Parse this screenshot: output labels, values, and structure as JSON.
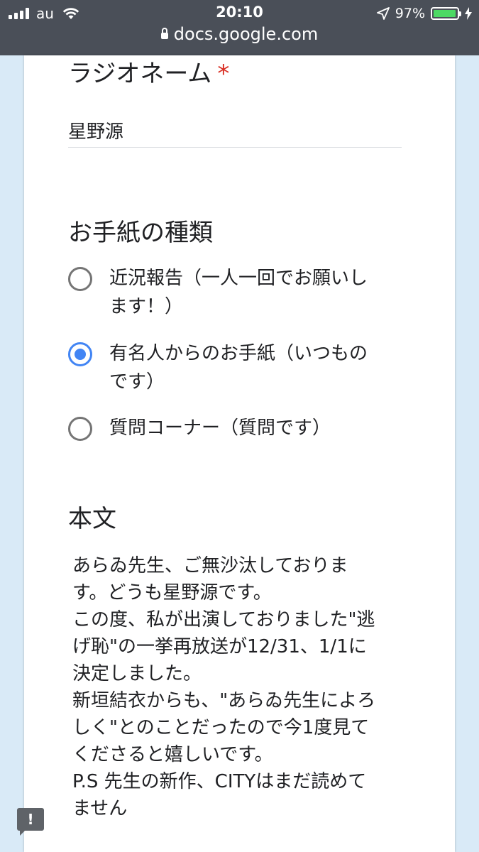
{
  "status_bar": {
    "carrier": "au",
    "time": "20:10",
    "battery": "97%",
    "battery_level": 0.97,
    "url": "docs.google.com"
  },
  "form": {
    "name_question": {
      "title": "ラジオネーム",
      "required_mark": "*",
      "answer": "星野源"
    },
    "type_question": {
      "title": "お手紙の種類",
      "options": [
        {
          "line1": "近況報告（一人一回でお願いし",
          "line2": "ます！）",
          "selected": false
        },
        {
          "line1": "有名人からのお手紙（いつもの",
          "line2": "です）",
          "selected": true
        },
        {
          "line1": "質問コーナー（質問です）",
          "line2": "",
          "selected": false
        }
      ]
    },
    "body_question": {
      "title": "本文",
      "lines": [
        "あらゐ先生、ご無沙汰しておりま",
        "す。どうも星野源です。",
        "この度、私が出演しておりました\"逃",
        "げ恥\"の一挙再放送が12/31、1/1に",
        "決定しました。",
        "新垣結衣からも、\"あらゐ先生によろ",
        "しく\"とのことだったので今1度見て",
        "くださると嬉しいです。",
        "P.S 先生の新作、CITYはまだ読めて",
        "ません"
      ]
    }
  },
  "report_button": "!",
  "colors": {
    "status_bar_bg": "#4a4f58",
    "radio_selected": "#4285f4",
    "required": "#d93025",
    "battery": "#4cd964"
  }
}
